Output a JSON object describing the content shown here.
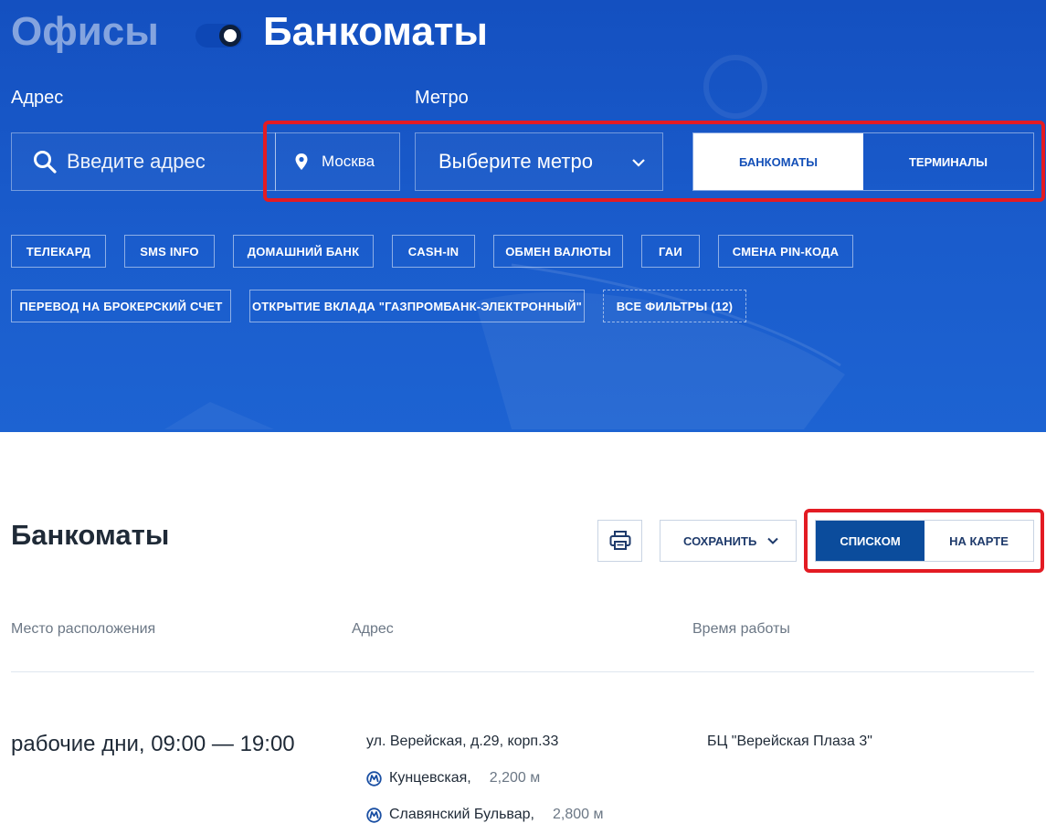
{
  "header": {
    "mode_inactive": "Офисы",
    "mode_active": "Банкоматы",
    "address_label": "Адрес",
    "metro_label": "Метро",
    "address_placeholder": "Введите адрес",
    "city": "Москва",
    "metro_placeholder": "Выберите метро",
    "type_tabs": [
      {
        "label": "БАНКОМАТЫ",
        "active": true
      },
      {
        "label": "ТЕРМИНАЛЫ",
        "active": false
      }
    ]
  },
  "filters": [
    {
      "label": "ТЕЛЕКАРД"
    },
    {
      "label": "SMS INFO"
    },
    {
      "label": "ДОМАШНИЙ БАНК"
    },
    {
      "label": "CASH-IN"
    },
    {
      "label": "ОБМЕН ВАЛЮТЫ"
    },
    {
      "label": "ГАИ"
    },
    {
      "label": "СМЕНА PIN-КОДА"
    },
    {
      "label": "ПЕРЕВОД НА БРОКЕРСКИЙ СЧЕТ"
    },
    {
      "label": "ОТКРЫТИЕ ВКЛАДА \"ГАЗПРОМБАНК-ЭЛЕКТРОННЫЙ\""
    },
    {
      "label": "ВСЕ ФИЛЬТРЫ (12)"
    }
  ],
  "main": {
    "title": "Банкоматы",
    "save_label": "СОХРАНИТЬ",
    "view_tabs": [
      {
        "label": "СПИСКОМ",
        "active": true
      },
      {
        "label": "НА КАРТЕ",
        "active": false
      }
    ],
    "columns": [
      "Место расположения",
      "Адрес",
      "Время работы"
    ],
    "rows": [
      {
        "hours": "рабочие дни, 09:00 — 19:00",
        "address": "ул. Верейская, д.29, корп.33",
        "place": "БЦ \"Верейская Плаза 3\"",
        "metro": [
          {
            "station": "Кунцевская,",
            "distance": "2,200 м"
          },
          {
            "station": "Славянский Бульвар,",
            "distance": "2,800 м"
          }
        ]
      }
    ]
  },
  "colors": {
    "hero_blue": "#1a5ccc",
    "active_tab_blue": "#0b4c9c",
    "highlight_red": "#e31b23"
  },
  "icons": [
    "search-icon",
    "location-pin-icon",
    "chevron-down-icon",
    "printer-icon",
    "metro-icon"
  ]
}
